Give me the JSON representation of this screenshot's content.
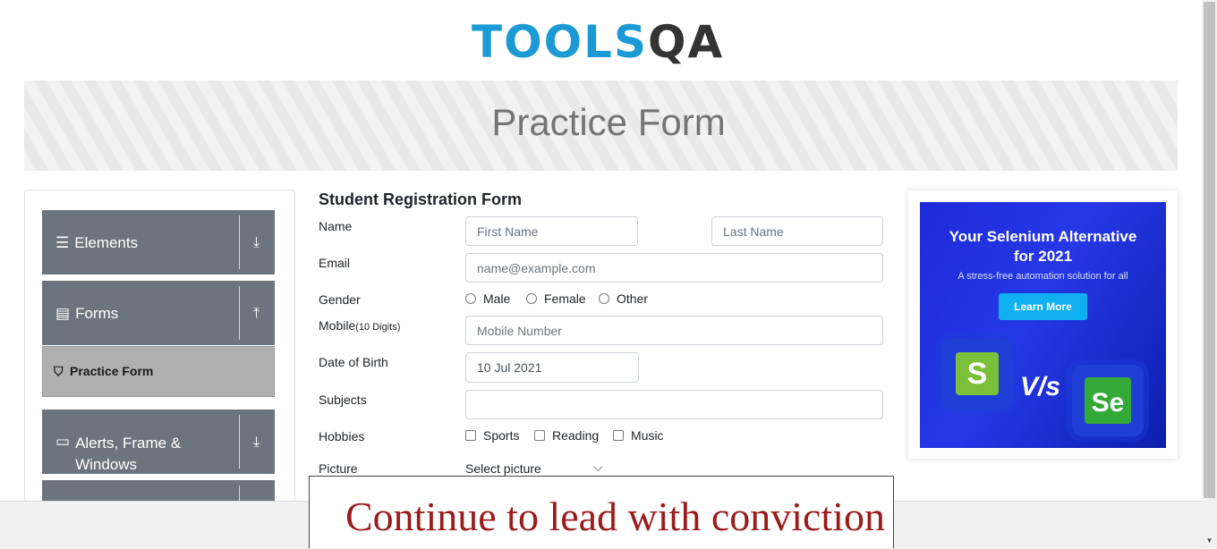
{
  "logo": {
    "part1": "TOOLS",
    "part2": "QA"
  },
  "banner": {
    "title": "Practice Form"
  },
  "sidebar": {
    "groups": [
      {
        "label": "Elements",
        "icon": "list-icon",
        "arrow": "download-arrow-icon"
      },
      {
        "label": "Forms",
        "icon": "document-icon",
        "arrow": "upload-arrow-icon"
      },
      {
        "label_line1": "Alerts, Frame &",
        "label_line2": "Windows",
        "icon": "window-icon",
        "arrow": "download-arrow-icon"
      }
    ],
    "active_item": {
      "label": "Practice Form",
      "icon": "html5-icon"
    }
  },
  "form": {
    "title": "Student Registration Form",
    "name_label": "Name",
    "first_name_placeholder": "First Name",
    "last_name_placeholder": "Last Name",
    "email_label": "Email",
    "email_placeholder": "name@example.com",
    "gender_label": "Gender",
    "gender_options": [
      "Male",
      "Female",
      "Other"
    ],
    "mobile_label": "Mobile",
    "mobile_hint": "(10 Digits)",
    "mobile_placeholder": "Mobile Number",
    "dob_label": "Date of Birth",
    "dob_value": "10 Jul 2021",
    "subjects_label": "Subjects",
    "hobbies_label": "Hobbies",
    "hobbies_options": [
      "Sports",
      "Reading",
      "Music"
    ],
    "picture_label": "Picture",
    "picture_button": "Select picture"
  },
  "ad": {
    "heading_line1": "Your Selenium Alternative",
    "heading_line2": "for 2021",
    "subtitle": "A stress-free automation solution for all",
    "button": "Learn More",
    "vs": "V/s",
    "left_logo": "S",
    "right_logo": "Se"
  },
  "footer_ad": {
    "text": "Continue to lead with conviction"
  },
  "colors": {
    "brand_blue": "#1b9ad6",
    "sidebar_gray": "#6c757d",
    "ad_blue": "#2638e6",
    "footer_red": "#9b1b1b"
  }
}
